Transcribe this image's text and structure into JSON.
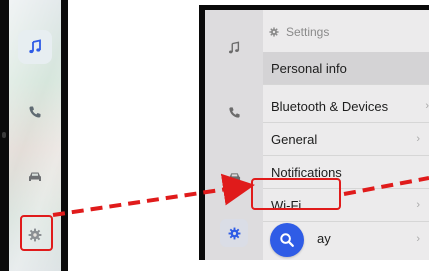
{
  "left_panel": {
    "icons": [
      "music-note-icon",
      "phone-icon",
      "car-icon",
      "gear-icon"
    ]
  },
  "settings_screen": {
    "header": {
      "icon": "gear-icon",
      "label": "Settings"
    },
    "rail_icons": [
      "music-note-icon",
      "phone-icon",
      "car-icon",
      "gear-icon"
    ],
    "items": [
      {
        "label": "Personal info",
        "chevron": ""
      },
      {
        "label": "Bluetooth & Devices",
        "chevron": "›"
      },
      {
        "label": "General",
        "chevron": "›"
      },
      {
        "label": "Notifications",
        "chevron": ""
      },
      {
        "label": "Wi-Fi",
        "chevron": "›"
      },
      {
        "label": "ay",
        "chevron": "›"
      }
    ],
    "search_button": {
      "icon": "search-icon",
      "color": "#2f5ce6"
    }
  },
  "annotations": {
    "highlight_color": "#e01b1b"
  }
}
